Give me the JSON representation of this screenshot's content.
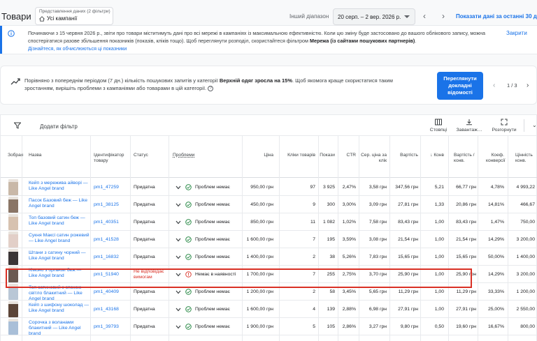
{
  "header": {
    "title": "Товари",
    "view": {
      "label": "Представлення даних (2 фільтри)",
      "value": "Усі кампанії"
    },
    "other_range_label": "Інший діапазон",
    "date_range": "20 серп. – 2 вер. 2026 р.",
    "show_30_days": "Показати дані за останні 30 днів"
  },
  "notice": {
    "text_before": "Починаючи з 15 червня 2026 р., звіти про товари міститимуть дані про всі мережі в кампаніях із максимальною ефективністю. Коли цю зміну буде застосовано до вашого облікового запису, можна спостерігатися разове збільшення показників (показів, кліків тощо). Щоб переглянути розподіл, скористайтеся фільтром ",
    "text_bold": "Мережа (із сайтами пошукових партнерів)",
    "text_after": ".",
    "link": "Дізнайтеся, як обчислюються ці показники",
    "close": "Закрити"
  },
  "insight": {
    "text_before": "Порівняно з попереднім періодом (7 дн.) кількість пошукових запитів у категорії ",
    "text_bold": "Верхній одяг зросла на 15%",
    "text_after": ". Щоб якомога краще скористатися таким зростанням, вирішіть проблеми з кампаніями або товарами в цій категорії.",
    "help": "?",
    "cta": "Переглянути докладні відомості",
    "pager": "1 / 3"
  },
  "toolbar": {
    "add_filter": "Додати фільтр",
    "columns": "Стовпці",
    "download": "Завантаж…",
    "expand": "Розгорнути",
    "more": "⌄"
  },
  "columns": {
    "image": "Зобрая",
    "name": "Назва",
    "id": "Ідентифікатор товару",
    "status": "Статус",
    "issues": "Проблеми",
    "price": "Ціна",
    "clicks": "Кліки товарів",
    "impr": "Покази",
    "ctr": "CTR",
    "cpc": "Сер. ціна за клік",
    "cost": "Вартість",
    "conv": "Конв",
    "cost_conv": "Вартість / конв.",
    "conv_rate": "Коеф. конверсії",
    "value": "Цінність конв."
  },
  "rows": [
    {
      "name": "Кейп з мереживa айворі — Like Angel brand",
      "id": "pm1_47259",
      "status": "Придатна",
      "issue": "Проблем немає",
      "ok": true,
      "price": "950,00 грн",
      "clicks": "97",
      "impr": "3 925",
      "ctr": "2,47%",
      "cpc": "3,58 грн",
      "cost": "347,56 грн",
      "conv": "5,21",
      "cost_conv": "66,77 грн",
      "conv_rate": "4,78%",
      "value": "4 993,22",
      "color": "#c9b8a8"
    },
    {
      "name": "Пасок Базовий беж — Like Angel brand",
      "id": "pm1_38125",
      "status": "Придатна",
      "issue": "Проблем немає",
      "ok": true,
      "price": "450,00 грн",
      "clicks": "9",
      "impr": "300",
      "ctr": "3,00%",
      "cpc": "3,09 грн",
      "cost": "27,81 грн",
      "conv": "1,33",
      "cost_conv": "20,86 грн",
      "conv_rate": "14,81%",
      "value": "466,67",
      "color": "#8a7566"
    },
    {
      "name": "Топ базовий сатин беж — Like Angel brand",
      "id": "pm1_40351",
      "status": "Придатна",
      "issue": "Проблем немає",
      "ok": true,
      "price": "850,00 грн",
      "clicks": "11",
      "impr": "1 082",
      "ctr": "1,02%",
      "cpc": "7,58 грн",
      "cost": "83,43 грн",
      "conv": "1,00",
      "cost_conv": "83,43 грн",
      "conv_rate": "1,47%",
      "value": "750,00",
      "color": "#d7c2b0"
    },
    {
      "name": "Сукня Максі сатин рожевий — Like Angel brand",
      "id": "pm1_41528",
      "status": "Придатна",
      "issue": "Проблем немає",
      "ok": true,
      "price": "1 600,00 грн",
      "clicks": "7",
      "impr": "195",
      "ctr": "3,59%",
      "cpc": "3,08 грн",
      "cost": "21,54 грн",
      "conv": "1,00",
      "cost_conv": "21,54 грн",
      "conv_rate": "14,29%",
      "value": "3 200,00",
      "color": "#e2cfc8"
    },
    {
      "name": "Штани з сатину чорний — Like Angel brand",
      "id": "pm1_16832",
      "status": "Придатна",
      "issue": "Проблем немає",
      "ok": true,
      "price": "1 400,00 грн",
      "clicks": "2",
      "impr": "38",
      "ctr": "5,26%",
      "cpc": "7,83 грн",
      "cost": "15,65 грн",
      "conv": "1,00",
      "cost_conv": "15,65 грн",
      "conv_rate": "50,00%",
      "value": "1 400,00",
      "color": "#3a3536"
    },
    {
      "name": "Кімоно з органзи беж — Like Angel brand",
      "id": "pm1_51940",
      "status": "Не відповідає вимогам",
      "bad": true,
      "issue": "Немає в наявності",
      "ok": false,
      "price": "1 700,00 грн",
      "clicks": "7",
      "impr": "255",
      "ctr": "2,75%",
      "cpc": "3,70 грн",
      "cost": "25,90 грн",
      "conv": "1,00",
      "cost_conv": "25,90 грн",
      "conv_rate": "14,29%",
      "value": "3 200,00",
      "color": "#6b5a52"
    },
    {
      "name": "Топ сатиновий з спокою світло блакитний — Like Angel brand",
      "id": "pm1_40409",
      "status": "Придатна",
      "issue": "Проблем немає",
      "ok": true,
      "price": "1 200,00 грн",
      "clicks": "2",
      "impr": "58",
      "ctr": "3,45%",
      "cpc": "5,65 грн",
      "cost": "11,29 грн",
      "conv": "1,00",
      "cost_conv": "11,29 грн",
      "conv_rate": "33,33%",
      "value": "1 200,00",
      "color": "#b9c7d6"
    },
    {
      "name": "Кейп з шифону шоколад — Like Angel brand",
      "id": "pm1_43168",
      "status": "Придатна",
      "issue": "Проблем немає",
      "ok": true,
      "price": "1 600,00 грн",
      "clicks": "4",
      "impr": "139",
      "ctr": "2,88%",
      "cpc": "6,98 грн",
      "cost": "27,91 грн",
      "conv": "1,00",
      "cost_conv": "27,91 грн",
      "conv_rate": "25,00%",
      "value": "2 550,00",
      "color": "#5c4538"
    },
    {
      "name": "Сорочка з воланами блакитний — Like Angel brand",
      "id": "pm1_39793",
      "status": "Придатна",
      "issue": "Проблем немає",
      "ok": true,
      "price": "1 900,00 грн",
      "clicks": "5",
      "impr": "105",
      "ctr": "2,86%",
      "cpc": "3,27 грн",
      "cost": "9,80 грн",
      "conv": "0,50",
      "cost_conv": "19,60 грн",
      "conv_rate": "16,67%",
      "value": "800,00",
      "color": "#a9bfd8"
    }
  ]
}
